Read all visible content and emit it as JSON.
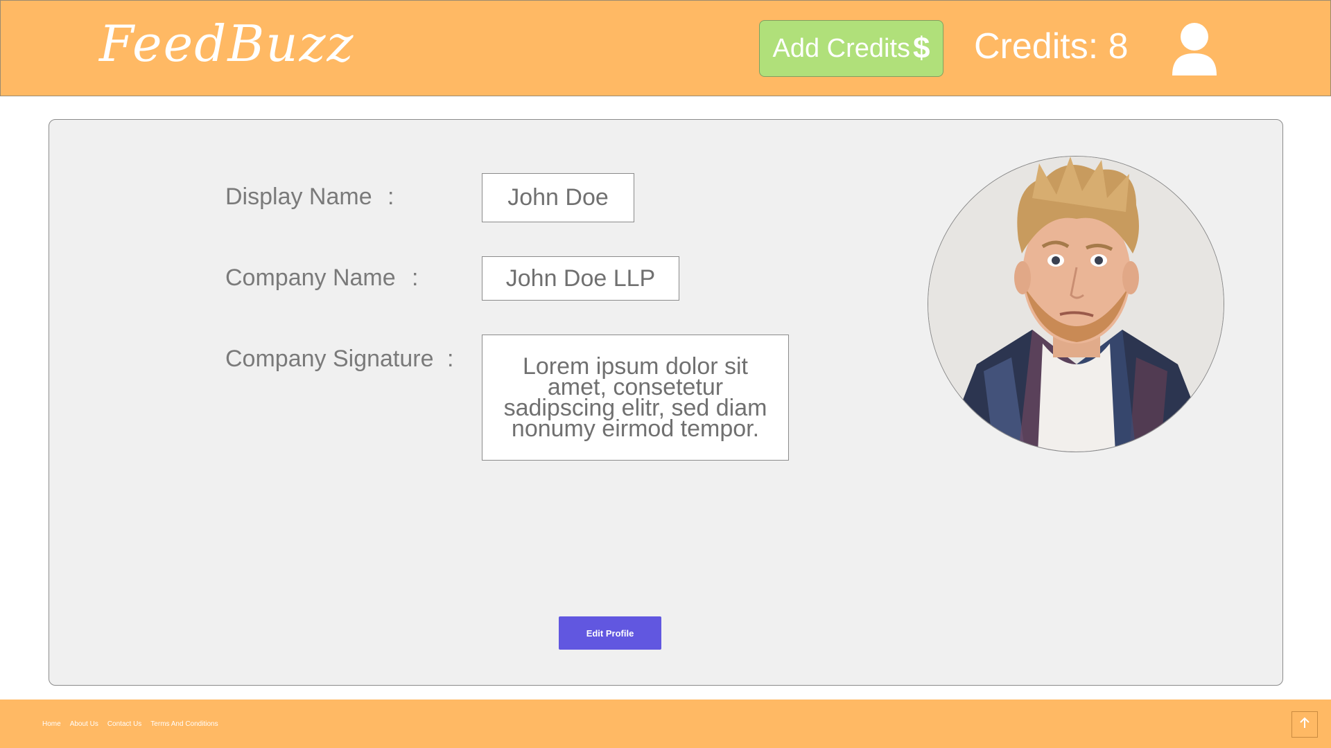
{
  "header": {
    "logo": "FeedBuzz",
    "add_credits_label": "Add Credits",
    "add_credits_icon": "dollar-icon",
    "credits_text": "Credits: 8",
    "user_icon": "user-icon"
  },
  "profile": {
    "fields": [
      {
        "label": "Display Name",
        "value": "John Doe"
      },
      {
        "label": "Company Name",
        "value": "John Doe LLP"
      },
      {
        "label": "Company Signature",
        "value": "Lorem ipsum dolor sit amet, consetetur sadipscing elitr, sed diam nonumy eirmod tempor."
      }
    ],
    "separator": ":",
    "edit_button": "Edit Profile"
  },
  "footer": {
    "links": [
      "Home",
      "About Us",
      "Contact Us",
      "Terms And Conditions"
    ],
    "top_icon": "arrow-up-icon"
  },
  "colors": {
    "header_bg": "#ffb964",
    "add_credits_bg": "#b0e07a",
    "edit_button_bg": "#6157e0",
    "card_bg": "#f0f0f0"
  }
}
